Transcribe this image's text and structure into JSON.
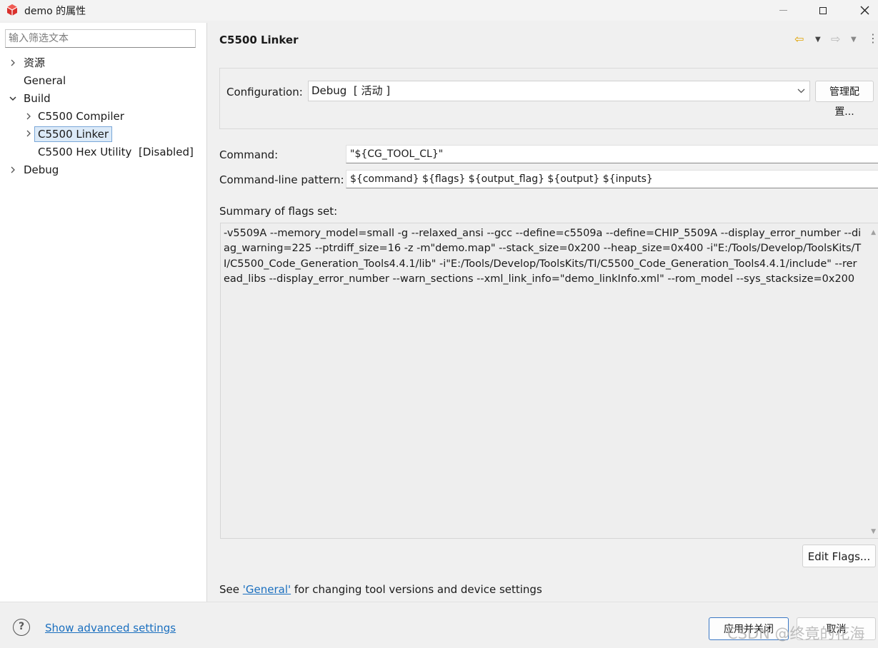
{
  "window": {
    "title": "demo 的属性",
    "app_icon": "red-cube-icon"
  },
  "sidebar": {
    "filter_placeholder": "输入筛选文本",
    "items": [
      {
        "label": "资源",
        "expander": "collapsed"
      },
      {
        "label": "General"
      },
      {
        "label": "Build",
        "expander": "expanded"
      },
      {
        "label": "C5500 Compiler",
        "expander": "collapsed"
      },
      {
        "label": "C5500 Linker",
        "expander": "collapsed",
        "selected": true
      },
      {
        "label": "C5500 Hex Utility  [Disabled]"
      },
      {
        "label": "Debug",
        "expander": "collapsed"
      }
    ]
  },
  "page": {
    "title": "C5500 Linker",
    "configuration": {
      "label": "Configuration:",
      "value": "Debug  [ 活动 ]",
      "manage_button": "管理配置..."
    },
    "command": {
      "label": "Command:",
      "value": "\"${CG_TOOL_CL}\""
    },
    "pattern": {
      "label": "Command-line pattern:",
      "value": "${command} ${flags} ${output_flag} ${output} ${inputs}"
    },
    "summary": {
      "label": "Summary of flags set:",
      "text": "-v5509A --memory_model=small -g --relaxed_ansi --gcc --define=c5509a --define=CHIP_5509A --display_error_number --diag_warning=225 --ptrdiff_size=16 -z -m\"demo.map\" --stack_size=0x200 --heap_size=0x400 -i\"E:/Tools/Develop/ToolsKits/TI/C5500_Code_Generation_Tools4.4.1/lib\" -i\"E:/Tools/Develop/ToolsKits/TI/C5500_Code_Generation_Tools4.4.1/include\" --reread_libs --display_error_number --warn_sections --xml_link_info=\"demo_linkInfo.xml\" --rom_model --sys_stacksize=0x200"
    },
    "edit_flags_button": "Edit Flags...",
    "see_prefix": "See ",
    "see_link": "'General'",
    "see_suffix": " for changing tool versions and device settings"
  },
  "footer": {
    "advanced_link": "Show advanced settings",
    "apply_button": "应用并关闭",
    "cancel_button": "取消",
    "watermark": "CSDN @终竟的花海"
  },
  "colors": {
    "accent": "#3b78c4",
    "link": "#1a6fbf",
    "back_arrow": "#e0a200",
    "selection": "#dceaf8"
  }
}
